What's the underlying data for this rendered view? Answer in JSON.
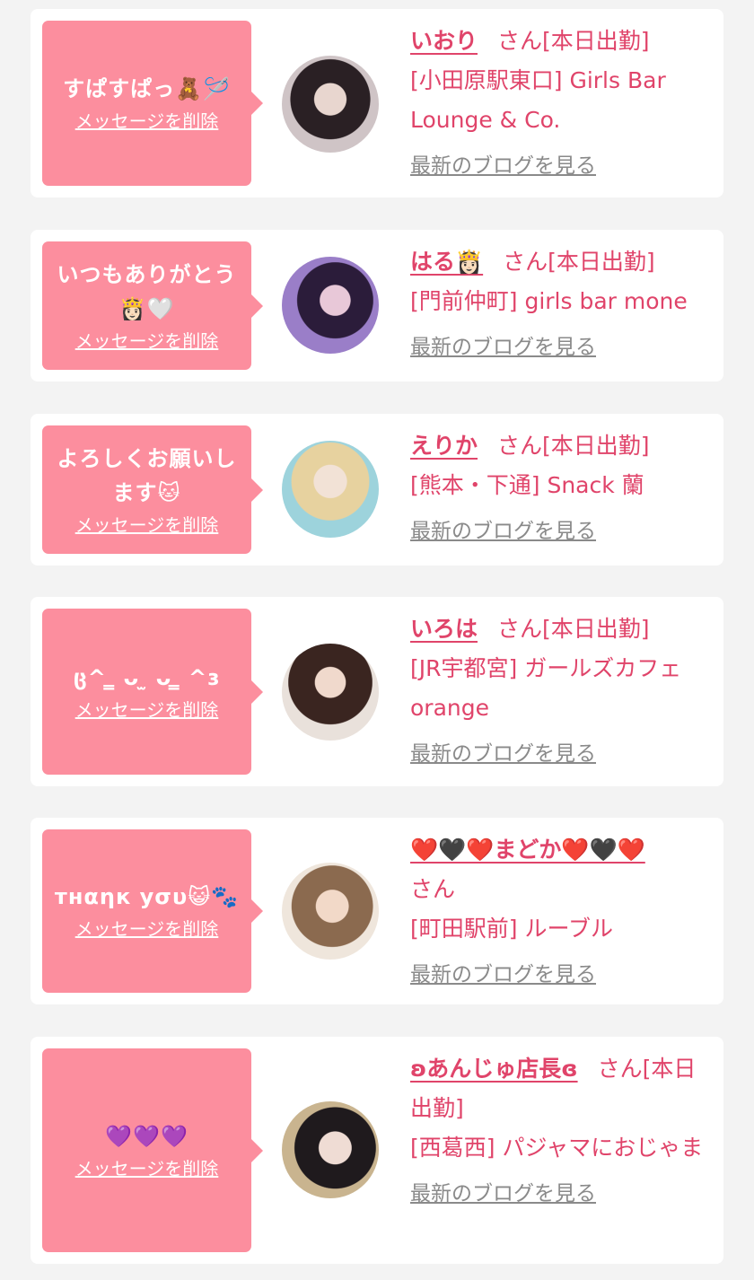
{
  "labels": {
    "delete_message": "メッセージを削除",
    "view_blog": "最新のブログを見る",
    "san": "さん"
  },
  "cards": [
    {
      "message": "すぱすぱっ🧸🪡",
      "name": "いおり",
      "status": "[本日出勤]",
      "shop": "[小田原駅東口] Girls Bar Lounge & Co."
    },
    {
      "message": "いつもありがとう👸🏻🤍",
      "name": "はる👸🏻",
      "status": "[本日出勤]",
      "shop": "[門前仲町] girls bar mone"
    },
    {
      "message": "よろしくお願いします🐱",
      "name": "えりか",
      "status": "[本日出勤]",
      "shop": "[熊本・下通] Snack 蘭"
    },
    {
      "message": "ც^ ̳ ᴗ ̫ ᴗ ̳ ^ɜ",
      "name": "いろは",
      "status": "[本日出勤]",
      "shop": "[JR宇都宮] ガールズカフェ orange"
    },
    {
      "message": "тнαηк уσυ😺🐾",
      "name": "❤️🖤❤️まどか❤️🖤❤️",
      "status": "",
      "shop": "[町田駅前] ルーブル"
    },
    {
      "message": "💜💜💜",
      "name": "ʚあんじゅ店長ɞ",
      "status": "[本日出勤]",
      "shop": "[西葛西] パジャマにおじゃま"
    }
  ]
}
